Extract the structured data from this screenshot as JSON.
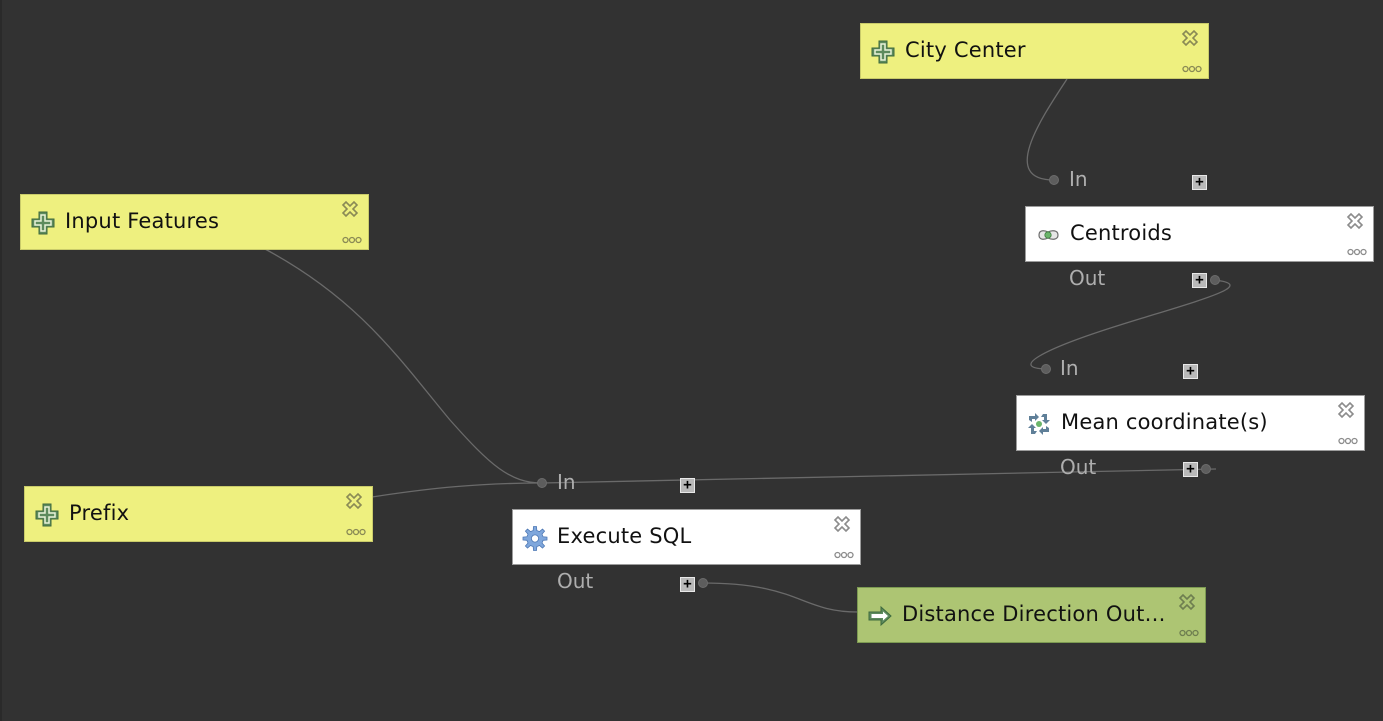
{
  "canvas": {
    "background": "#323232"
  },
  "nodes": {
    "city_center": {
      "title": "City Center",
      "type": "input",
      "icon": "plus-parameter-icon"
    },
    "input_features": {
      "title": "Input Features",
      "type": "input",
      "icon": "plus-parameter-icon"
    },
    "prefix": {
      "title": "Prefix",
      "type": "input",
      "icon": "plus-parameter-icon"
    },
    "centroids": {
      "title": "Centroids",
      "type": "algorithm",
      "icon": "centroid-icon",
      "in_label": "In",
      "out_label": "Out"
    },
    "mean_coordinates": {
      "title": "Mean coordinate(s)",
      "type": "algorithm",
      "icon": "mean-coordinates-icon",
      "in_label": "In",
      "out_label": "Out"
    },
    "execute_sql": {
      "title": "Execute SQL",
      "type": "algorithm",
      "icon": "gear-icon",
      "in_label": "In",
      "out_label": "Out"
    },
    "distance_direction_output": {
      "title": "Distance Direction Out…",
      "type": "output",
      "icon": "arrow-right-icon"
    }
  },
  "controls": {
    "expand_symbol": "+",
    "close_icon": "close-icon",
    "more_icon": "more-options-icon"
  },
  "colors": {
    "input_node": "#eef07f",
    "algorithm_node": "#ffffff",
    "output_node": "#adc573",
    "link": "#6a6a6a",
    "port_label": "#aeaeae"
  }
}
